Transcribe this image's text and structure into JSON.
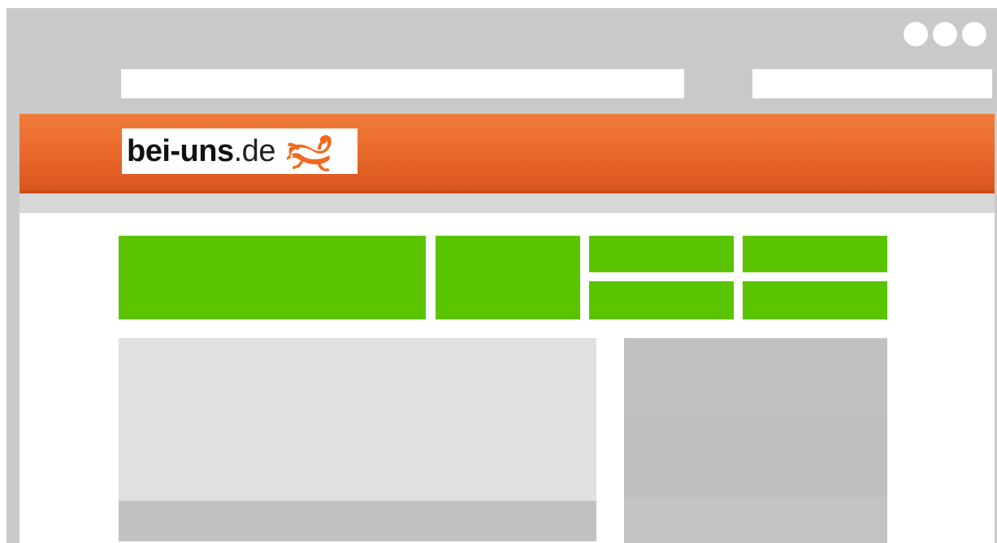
{
  "browser": {
    "window_controls": [
      "window-dot",
      "window-dot",
      "window-dot"
    ],
    "url_bar": {
      "value": ""
    },
    "search_bar": {
      "value": ""
    }
  },
  "site": {
    "logo": {
      "brand": "bei-uns",
      "tld": ".de",
      "icon": "gecko-icon"
    },
    "colors": {
      "header": "#e8672a",
      "tile": "#5bc400",
      "browser_chrome": "#cacaca"
    }
  }
}
